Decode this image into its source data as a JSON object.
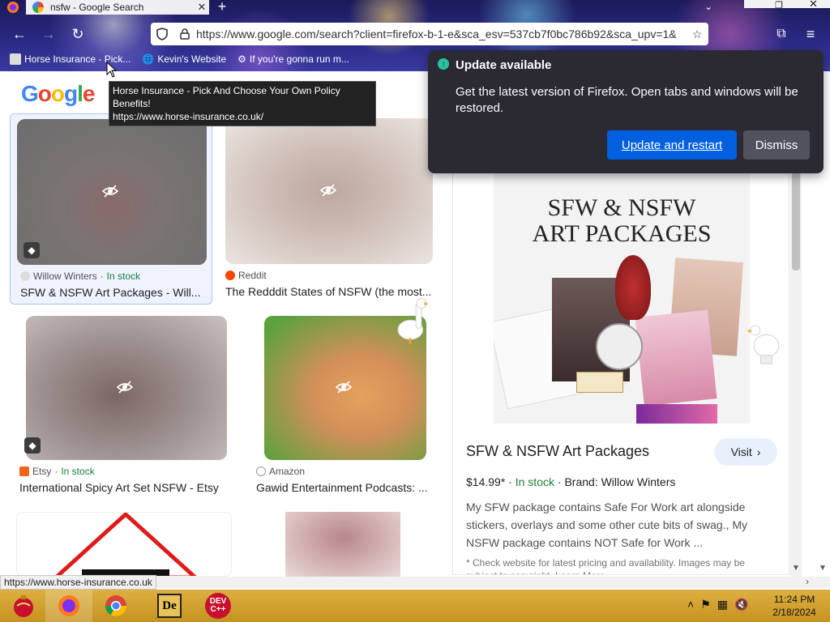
{
  "browser": {
    "tab_title": "nsfw - Google Search",
    "tab_close_glyph": "✕",
    "new_tab_glyph": "+",
    "url": "https://www.google.com/search?client=firefox-b-1-e&sca_esv=537cb7f0bc786b92&sca_upv=1&",
    "bookmarks": [
      {
        "label": "Horse Insurance - Pick..."
      },
      {
        "label": "Kevin's Website"
      },
      {
        "label": "If you're gonna run m..."
      }
    ],
    "tooltip_line1": "Horse Insurance - Pick And Choose Your Own Policy Benefits!",
    "tooltip_line2": "https://www.horse-insurance.co.uk/",
    "status_url": "https://www.horse-insurance.co.uk"
  },
  "google": {
    "logo_letters": [
      "G",
      "o",
      "o",
      "g",
      "l",
      "e"
    ]
  },
  "results": [
    {
      "source": "Willow Winters",
      "stock": "In stock",
      "title": "SFW & NSFW Art Packages - Will..."
    },
    {
      "source": "Reddit",
      "stock": "",
      "title": "The Redddit States of NSFW (the most..."
    },
    {
      "source": "Etsy",
      "stock": "In stock",
      "title": "International Spicy Art Set NSFW - Etsy"
    },
    {
      "source": "Amazon",
      "stock": "",
      "title": "Gawid Entertainment Podcasts: ..."
    }
  ],
  "panel": {
    "image_title_line1": "SFW & NSFW",
    "image_title_line2": "ART PACKAGES",
    "title": "SFW & NSFW Art Packages",
    "visit_label": "Visit",
    "price": "$14.99*",
    "stock": "In stock",
    "brand": "Brand: Willow Winters",
    "description": "My SFW package contains Safe For Work art alongside stickers, overlays and some other cute bits of swag., My NSFW package contains NOT Safe for Work ...",
    "fine_print": "* Check website for latest pricing and availability. Images may be subject to copyright. Learn More"
  },
  "popup": {
    "heading": "Update available",
    "body": "Get the latest version of Firefox. Open tabs and windows will be restored.",
    "update_label": "Update and restart",
    "dismiss_label": "Dismiss"
  },
  "taskbar": {
    "time": "11:24 PM",
    "date": "2/18/2024"
  },
  "colors": {
    "in_stock": "#188038",
    "update_button": "#0060df",
    "popup_bg": "#2b2a33",
    "taskbar": "#d4a431"
  }
}
